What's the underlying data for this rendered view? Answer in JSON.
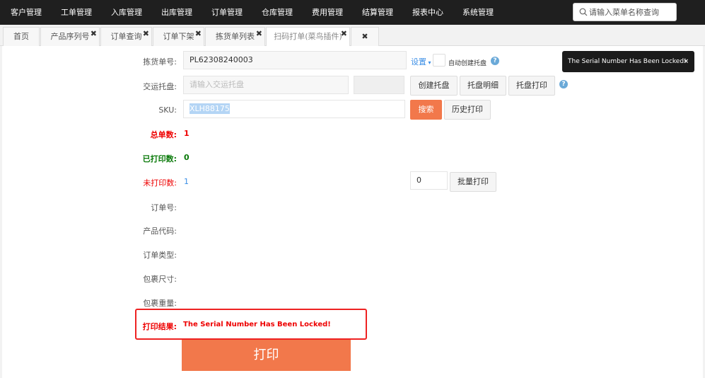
{
  "nav": {
    "items": [
      "客户管理",
      "工单管理",
      "入库管理",
      "出库管理",
      "订单管理",
      "仓库管理",
      "费用管理",
      "结算管理",
      "报表中心",
      "系统管理"
    ],
    "search_placeholder": "请输入菜单名称查询"
  },
  "tabs": [
    {
      "label": "首页",
      "closable": false
    },
    {
      "label": "产品序列号",
      "closable": true
    },
    {
      "label": "订单查询",
      "closable": true
    },
    {
      "label": "订单下架",
      "closable": true
    },
    {
      "label": "拣货单列表",
      "closable": true
    },
    {
      "label": "扫码打单(菜鸟插件)",
      "closable": true,
      "active": true
    },
    {
      "label": "",
      "closable": true
    }
  ],
  "close_glyph": "✖",
  "form": {
    "pick_label": "拣货单号:",
    "pick_value": "PL62308240003",
    "settings_label": "设置",
    "auto_pallet_label": "自动创建托盘",
    "pallet_label": "交运托盘:",
    "pallet_placeholder": "请输入交运托盘",
    "create_pallet": "创建托盘",
    "pallet_detail": "托盘明细",
    "pallet_print": "托盘打印",
    "sku_label": "SKU:",
    "sku_value": "XLH88175",
    "search_btn": "搜索",
    "history_btn": "历史打印",
    "total_label": "总单数:",
    "total_value": "1",
    "printed_label": "已打印数:",
    "printed_value": "0",
    "unprinted_label": "未打印数:",
    "unprinted_value": "1",
    "batch_qty": "0",
    "batch_print": "批量打印",
    "order_no_label": "订单号:",
    "product_code_label": "产品代码:",
    "order_type_label": "订单类型:",
    "package_size_label": "包裹尺寸:",
    "package_weight_label": "包裹重量:",
    "result_label": "打印结果:",
    "result_value": "The Serial Number Has Been Locked!",
    "print_btn": "打印"
  },
  "toast": {
    "message": "The Serial Number Has Been Locked!",
    "close": "×"
  },
  "colors": {
    "accent": "#f2784b",
    "nav_bg": "#1f1f1f",
    "error": "#e00000",
    "success": "#0a7a0a"
  }
}
